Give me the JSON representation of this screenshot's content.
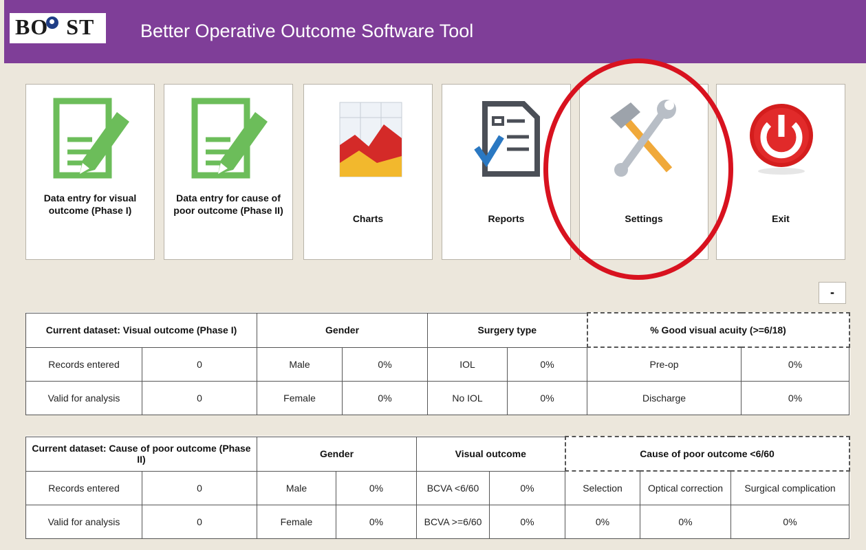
{
  "app": {
    "logo": "BOOST",
    "logo_left": "BO",
    "logo_right": "ST",
    "title": "Better Operative Outcome Software Tool"
  },
  "tiles": [
    {
      "label": "Data entry for visual outcome (Phase I)",
      "icon": "data-entry-icon"
    },
    {
      "label": "Data entry for cause of poor outcome (Phase II)",
      "icon": "data-entry-icon"
    },
    {
      "label": "Charts",
      "icon": "chart-icon"
    },
    {
      "label": "Reports",
      "icon": "report-icon"
    },
    {
      "label": "Settings",
      "icon": "tools-icon"
    },
    {
      "label": "Exit",
      "icon": "power-icon"
    }
  ],
  "collapse_button": "-",
  "table1": {
    "dataset_title": "Current dataset: Visual outcome (Phase I)",
    "groups": [
      "Gender",
      "Surgery type",
      "% Good visual acuity (>=6/18)"
    ],
    "rows": [
      [
        "Records entered",
        "0",
        "Male",
        "0%",
        "IOL",
        "0%",
        "Pre-op",
        "0%"
      ],
      [
        "Valid for analysis",
        "0",
        "Female",
        "0%",
        "No IOL",
        "0%",
        "Discharge",
        "0%"
      ]
    ]
  },
  "table2": {
    "dataset_title": "Current dataset: Cause of poor outcome (Phase II)",
    "groups": [
      "Gender",
      "Visual outcome",
      "Cause of poor outcome <6/60"
    ],
    "rows": [
      [
        "Records entered",
        "0",
        "Male",
        "0%",
        "BCVA <6/60",
        "0%",
        "Selection",
        "Optical correction",
        "Surgical complication"
      ],
      [
        "Valid for analysis",
        "0",
        "Female",
        "0%",
        "BCVA >=6/60",
        "0%",
        "0%",
        "0%",
        "0%"
      ]
    ]
  },
  "colors": {
    "header": "#7f3e98",
    "background": "#ece7dc",
    "highlight_circle": "#d8121f"
  }
}
